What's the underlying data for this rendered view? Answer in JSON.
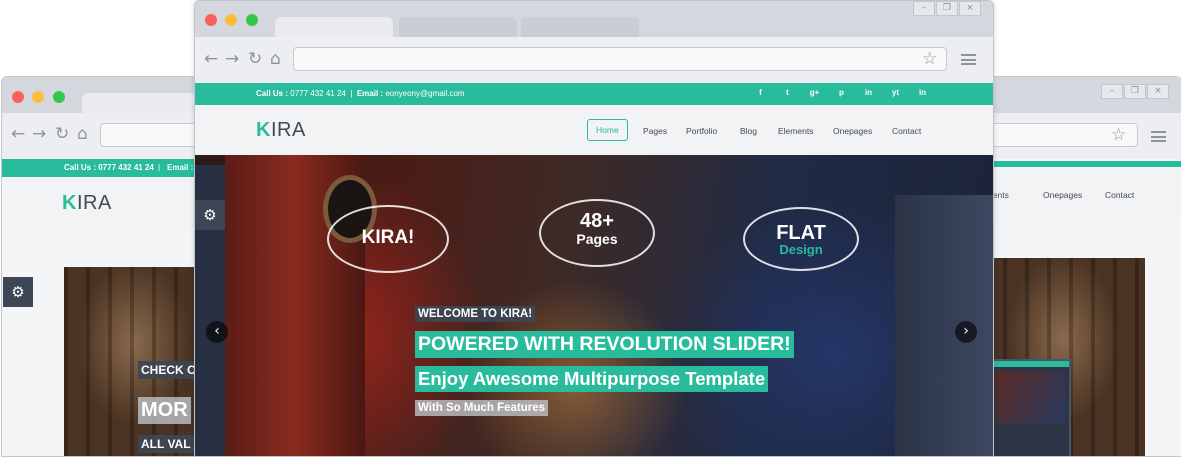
{
  "browser": {
    "back_icon": "arrow-left",
    "forward_icon": "arrow-right",
    "reload_icon": "reload",
    "home_icon": "home",
    "star_icon": "star",
    "menu_icon": "hamburger",
    "minimize": "–",
    "restore": "❐",
    "close": "×"
  },
  "site": {
    "call_label": "Call Us :",
    "phone": "0777 432 41 24",
    "separator": "|",
    "email_label": "Email :",
    "email": "eonyeony@gmail.com",
    "logo_k": "K",
    "logo_rest": "IRA",
    "social": [
      "f",
      "t",
      "g+",
      "p",
      "in",
      "yt",
      "in"
    ],
    "nav": [
      "Home",
      "Pages",
      "Portfolio",
      "Blog",
      "Elements",
      "Onepages",
      "Contact"
    ]
  },
  "slider": {
    "bubble_1": "KIRA!",
    "bubble_2_num": "48+",
    "bubble_2_text": "Pages",
    "bubble_3_main": "FLAT",
    "bubble_3_sub": "Design",
    "welcome": "WELCOME TO KIRA!",
    "powered": "POWERED WITH REVOLUTION SLIDER!",
    "enjoy": "Enjoy Awesome Multipurpose Template",
    "features": "With So Much Features",
    "prev_icon": "‹",
    "next_icon": "›"
  },
  "left_window": {
    "call_text": "Call Us : 0777 432 41 24",
    "sep": "|",
    "email_trunc": "Email : e",
    "check": "CHECK O",
    "more": "MOR",
    "all": "ALL VAL"
  },
  "right_window": {
    "nav": [
      "ements",
      "Onepages",
      "Contact"
    ]
  },
  "colors": {
    "accent": "#29bc9c",
    "dark_caption": "#3c4654",
    "topbar_text": "#ffffff"
  }
}
